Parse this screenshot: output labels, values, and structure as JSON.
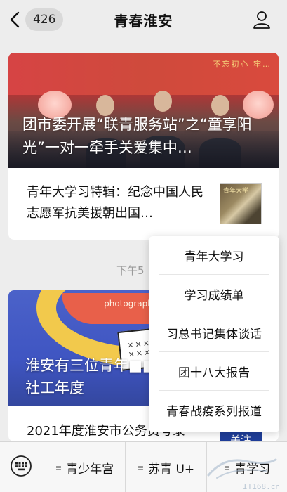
{
  "header": {
    "back_count": "426",
    "title": "青春淮安"
  },
  "feed": {
    "article1": {
      "hero_title": "团市委开展“联青服务站”之“童享阳光”一对一牵手关爱集中…",
      "banner_text": "不忘初心 牢…",
      "sub_title": "青年大学习特辑：纪念中国人民志愿军抗美援朝出国…",
      "thumb_text": "青年大学"
    },
    "timestamp": "下午5",
    "article2": {
      "tag_text": "- photographic",
      "paper_marks": "××× ×××",
      "hero_title": "淮安有三位青年■■■■■少年事务社工年度",
      "sub_title": "2021年度淮安市公务员考录",
      "thumb_text": "关注"
    }
  },
  "menu": {
    "items": [
      "青年大学习",
      "学习成绩单",
      "习总书记集体谈话",
      "团十八大报告",
      "青春战疫系列报道"
    ]
  },
  "bottom_bar": {
    "items": [
      "青少年宫",
      "苏青 U+",
      "青学习"
    ]
  },
  "watermark": {
    "text": "IT168.cn"
  },
  "colors": {
    "background": "#ededed",
    "card": "#ffffff",
    "text": "#111111",
    "muted": "#9a9a9a"
  }
}
